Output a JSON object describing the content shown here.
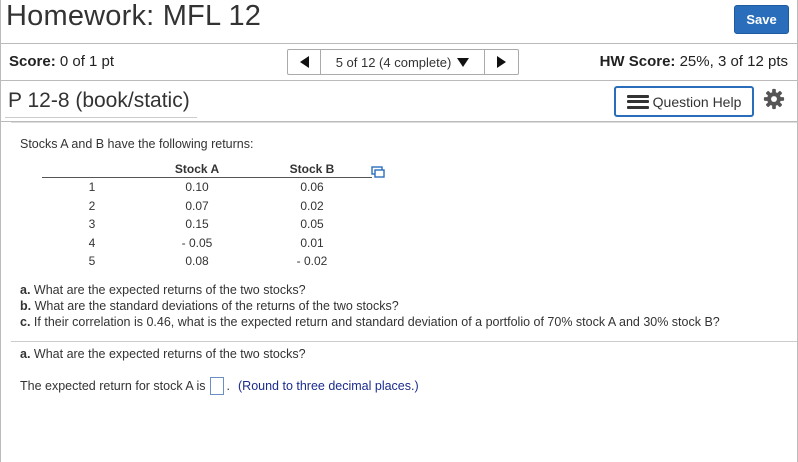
{
  "header": {
    "title": "Homework: MFL 12",
    "save_label": "Save"
  },
  "score_bar": {
    "score_label": "Score:",
    "score_value": "0 of 1 pt",
    "nav_label": "5 of 12 (4 complete)",
    "hw_score_label": "HW Score:",
    "hw_score_value": "25%, 3 of 12 pts"
  },
  "problem": {
    "title": "P 12-8 (book/static)",
    "help_label": "Question Help"
  },
  "content": {
    "intro": "Stocks A and B have the following returns:",
    "table": {
      "headers": [
        "",
        "Stock A",
        "Stock B"
      ],
      "rows": [
        [
          "1",
          "0.10",
          "0.06"
        ],
        [
          "2",
          "0.07",
          "0.02"
        ],
        [
          "3",
          "0.15",
          "0.05"
        ],
        [
          "4",
          "- 0.05",
          "0.01"
        ],
        [
          "5",
          "0.08",
          "- 0.02"
        ]
      ]
    },
    "questions": [
      {
        "label": "a.",
        "text": "What are the expected returns of the two stocks?"
      },
      {
        "label": "b.",
        "text": "What are the standard deviations of the returns of the two stocks?"
      },
      {
        "label": "c.",
        "text": "If their correlation is 0.46, what is the expected return and standard deviation of a portfolio of 70% stock A and 30% stock B?"
      }
    ],
    "part_a": {
      "label": "a.",
      "text": "What are the expected returns of the two stocks?"
    },
    "answer_prompt": "The expected return for stock A is",
    "answer_suffix": ".",
    "hint": "(Round to three decimal places.)"
  },
  "colors": {
    "accent": "#2a6ebb",
    "hint_text": "#1b2c8c"
  },
  "icons": [
    "triangle-left-icon",
    "triangle-down-icon",
    "triangle-right-icon",
    "list-icon",
    "gear-icon",
    "copy-icon"
  ]
}
